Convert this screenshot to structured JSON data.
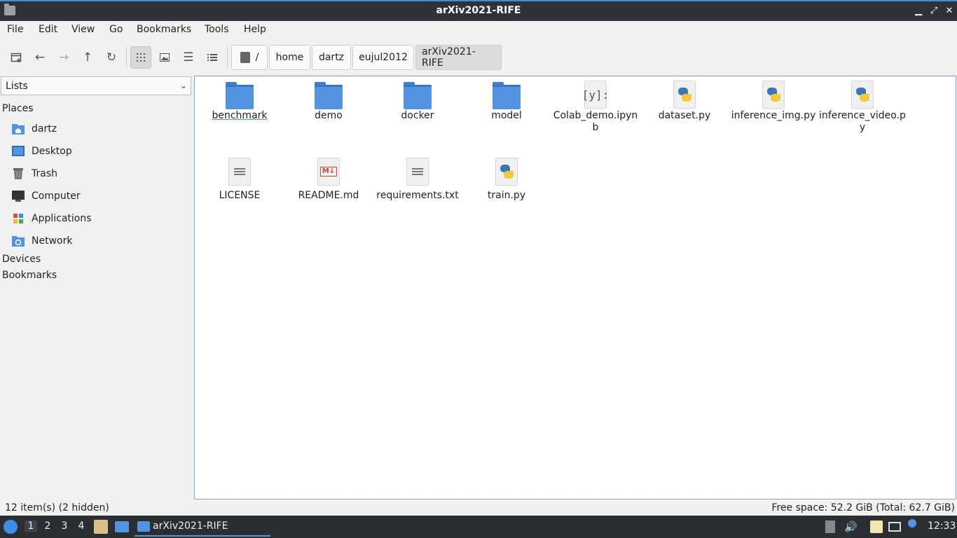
{
  "window": {
    "title": "arXiv2021-RIFE"
  },
  "menubar": [
    "File",
    "Edit",
    "View",
    "Go",
    "Bookmarks",
    "Tools",
    "Help"
  ],
  "breadcrumb": {
    "root": "/",
    "items": [
      "home",
      "dartz",
      "eujul2012",
      "arXiv2021-RIFE"
    ]
  },
  "sidebar": {
    "selector": "Lists",
    "places_label": "Places",
    "places": [
      {
        "label": "dartz",
        "icon": "home-folder-icon"
      },
      {
        "label": "Desktop",
        "icon": "desktop-icon"
      },
      {
        "label": "Trash",
        "icon": "trash-icon"
      },
      {
        "label": "Computer",
        "icon": "computer-icon"
      },
      {
        "label": "Applications",
        "icon": "applications-icon"
      },
      {
        "label": "Network",
        "icon": "network-icon"
      }
    ],
    "devices_label": "Devices",
    "bookmarks_label": "Bookmarks"
  },
  "files": [
    {
      "name": "benchmark",
      "type": "folder"
    },
    {
      "name": "demo",
      "type": "folder"
    },
    {
      "name": "docker",
      "type": "folder"
    },
    {
      "name": "model",
      "type": "folder"
    },
    {
      "name": "Colab_demo.ipynb",
      "type": "notebook",
      "badge": "[y]:"
    },
    {
      "name": "dataset.py",
      "type": "python"
    },
    {
      "name": "inference_img.py",
      "type": "python"
    },
    {
      "name": "inference_video.py",
      "type": "python"
    },
    {
      "name": "LICENSE",
      "type": "text"
    },
    {
      "name": "README.md",
      "type": "markdown",
      "badge": "M↓"
    },
    {
      "name": "requirements.txt",
      "type": "text"
    },
    {
      "name": "train.py",
      "type": "python"
    }
  ],
  "status": {
    "left": "12 item(s) (2 hidden)",
    "right": "Free space: 52.2 GiB (Total: 62.7 GiB)"
  },
  "taskbar": {
    "workspaces": [
      "1",
      "2",
      "3",
      "4"
    ],
    "task_label": "arXiv2021-RIFE",
    "clock": "12:33"
  },
  "colors": {
    "accent": "#5294e2",
    "titlebar": "#2e333a",
    "taskbar": "#2b2f34"
  }
}
